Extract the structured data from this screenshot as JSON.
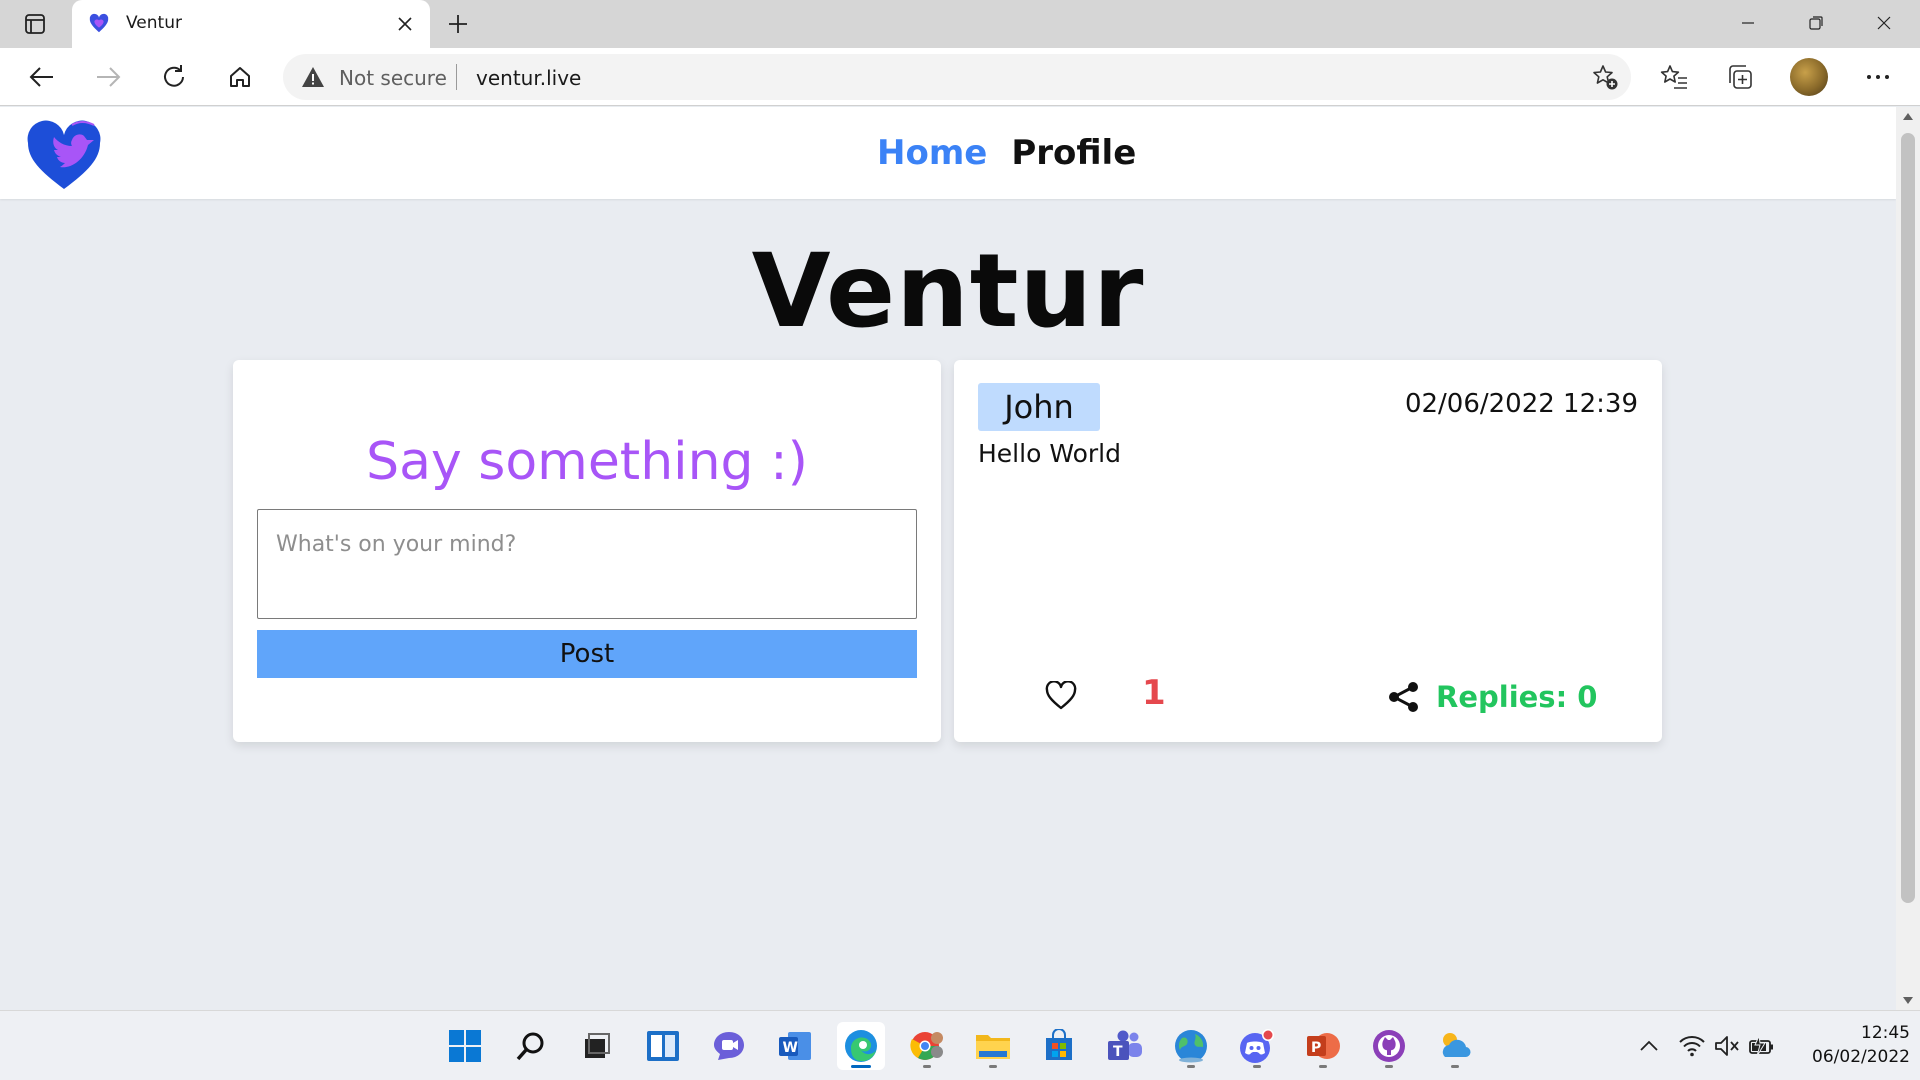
{
  "browser": {
    "tab_title": "Ventur",
    "address": {
      "security_label": "Not secure",
      "url": "ventur.live"
    }
  },
  "site": {
    "nav": {
      "home": "Home",
      "profile": "Profile"
    },
    "title": "Ventur"
  },
  "composer": {
    "heading": "Say something :)",
    "placeholder": "What's on your mind?",
    "button_label": "Post"
  },
  "post": {
    "author": "John",
    "date": "02/06/2022 12:39",
    "body": "Hello World",
    "likes": "1",
    "replies": "Replies: 0"
  },
  "taskbar": {
    "time": "12:45",
    "date": "06/02/2022"
  },
  "colors": {
    "nav_active": "#3b82f6",
    "composer_heading": "#a855f7",
    "post_button": "#60a5fa",
    "author_badge": "#bfdbfe",
    "like_count": "#e5484d",
    "replies": "#22c55e"
  }
}
